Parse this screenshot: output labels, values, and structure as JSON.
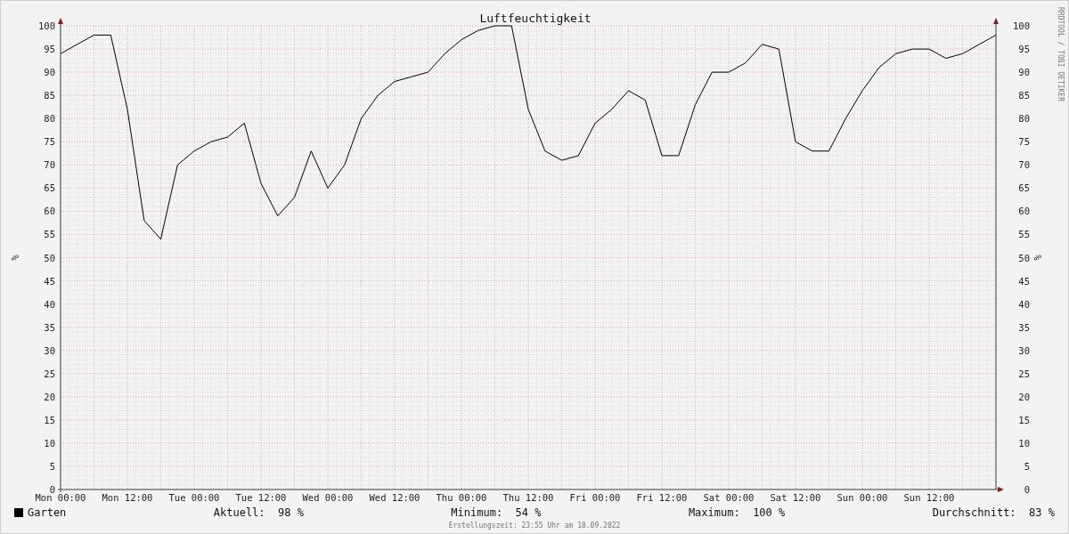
{
  "chart_data": {
    "type": "line",
    "title": "Luftfeuchtigkeit",
    "ylabel": "%",
    "ylim": [
      0,
      100
    ],
    "grid": true,
    "categories": [
      "Mon 00:00",
      null,
      null,
      null,
      "Mon 12:00",
      null,
      null,
      null,
      "Tue 00:00",
      null,
      null,
      null,
      "Tue 12:00",
      null,
      null,
      null,
      "Wed 00:00",
      null,
      null,
      null,
      "Wed 12:00",
      null,
      null,
      null,
      "Thu 00:00",
      null,
      null,
      null,
      "Thu 12:00",
      null,
      null,
      null,
      "Fri 00:00",
      null,
      null,
      null,
      "Fri 12:00",
      null,
      null,
      null,
      "Sat 00:00",
      null,
      null,
      null,
      "Sat 12:00",
      null,
      null,
      null,
      "Sun 00:00",
      null,
      null,
      null,
      "Sun 12:00",
      null,
      null,
      null,
      null
    ],
    "series": [
      {
        "name": "Garten",
        "color": "#000000",
        "values": [
          94,
          96,
          98,
          98,
          82,
          58,
          54,
          70,
          73,
          75,
          76,
          79,
          66,
          59,
          63,
          73,
          65,
          70,
          80,
          85,
          88,
          89,
          90,
          94,
          97,
          99,
          100,
          100,
          82,
          73,
          71,
          72,
          79,
          82,
          86,
          84,
          72,
          72,
          83,
          90,
          90,
          92,
          96,
          95,
          75,
          73,
          73,
          80,
          86,
          91,
          94,
          95,
          95,
          93,
          94,
          96,
          98
        ]
      }
    ],
    "yticks": [
      0,
      5,
      10,
      15,
      20,
      25,
      30,
      35,
      40,
      45,
      50,
      55,
      60,
      65,
      70,
      75,
      80,
      85,
      90,
      95,
      100
    ]
  },
  "right_axis": {
    "label": "%",
    "ticks": [
      "100",
      "95",
      "90",
      "85",
      "80",
      "75",
      "70",
      "65",
      "60",
      "55",
      "50",
      "45",
      "40",
      "35",
      "30",
      "25",
      "20",
      "15",
      "10",
      "5",
      "0"
    ]
  },
  "credit": "RRDTOOL / TOBI OETIKER",
  "legend": {
    "stats": [
      {
        "label": "Aktuell:",
        "value": "98 %"
      },
      {
        "label": "Minimum:",
        "value": "54 %"
      },
      {
        "label": "Maximum:",
        "value": "100 %"
      },
      {
        "label": "Durchschnitt:",
        "value": "83 %"
      }
    ]
  },
  "footer": "Erstellungszeit: 23:55 Uhr am 18.09.2022"
}
